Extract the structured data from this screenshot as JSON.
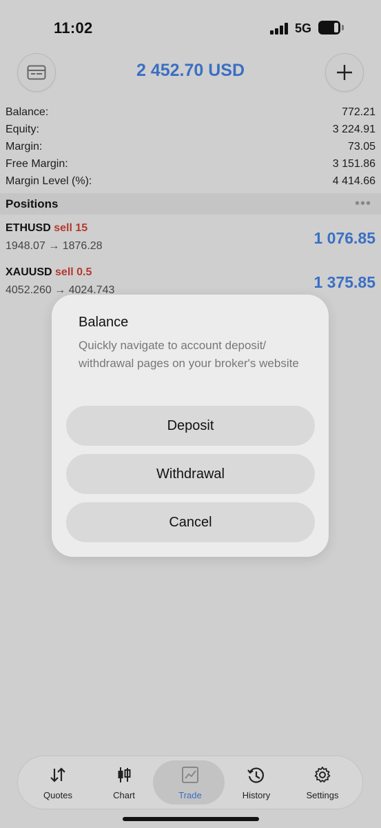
{
  "status_bar": {
    "time": "11:02",
    "network": "5G"
  },
  "header": {
    "balance_title": "2 452.70 USD",
    "left_icon": "card-icon",
    "right_icon": "plus-icon"
  },
  "account": [
    {
      "label": "Balance:",
      "value": "772.21"
    },
    {
      "label": "Equity:",
      "value": "3 224.91"
    },
    {
      "label": "Margin:",
      "value": "73.05"
    },
    {
      "label": "Free Margin:",
      "value": "3 151.86"
    },
    {
      "label": "Margin Level (%):",
      "value": "4 414.66"
    }
  ],
  "positions": {
    "title": "Positions",
    "more": "•••",
    "items": [
      {
        "symbol": "ETHUSD",
        "side": "sell 15",
        "prices": "1948.07 → 1876.28",
        "profit": "1 076.85"
      },
      {
        "symbol": "XAUUSD",
        "side": "sell 0.5",
        "prices": "4052.260 → 4024.743",
        "profit": "1 375.85"
      }
    ]
  },
  "dialog": {
    "title": "Balance",
    "message": "Quickly navigate to account deposit/ withdrawal pages on your broker's website",
    "buttons": [
      "Deposit",
      "Withdrawal",
      "Cancel"
    ]
  },
  "tabs": [
    {
      "label": "Quotes",
      "icon": "quotes-arrows-icon"
    },
    {
      "label": "Chart",
      "icon": "candlestick-icon"
    },
    {
      "label": "Trade",
      "icon": "trade-chart-icon",
      "active": true
    },
    {
      "label": "History",
      "icon": "history-clock-icon"
    },
    {
      "label": "Settings",
      "icon": "gear-icon"
    }
  ],
  "colors": {
    "accent": "#3a6fc4",
    "sell": "#b6392f",
    "background": "#cfcfcf"
  }
}
